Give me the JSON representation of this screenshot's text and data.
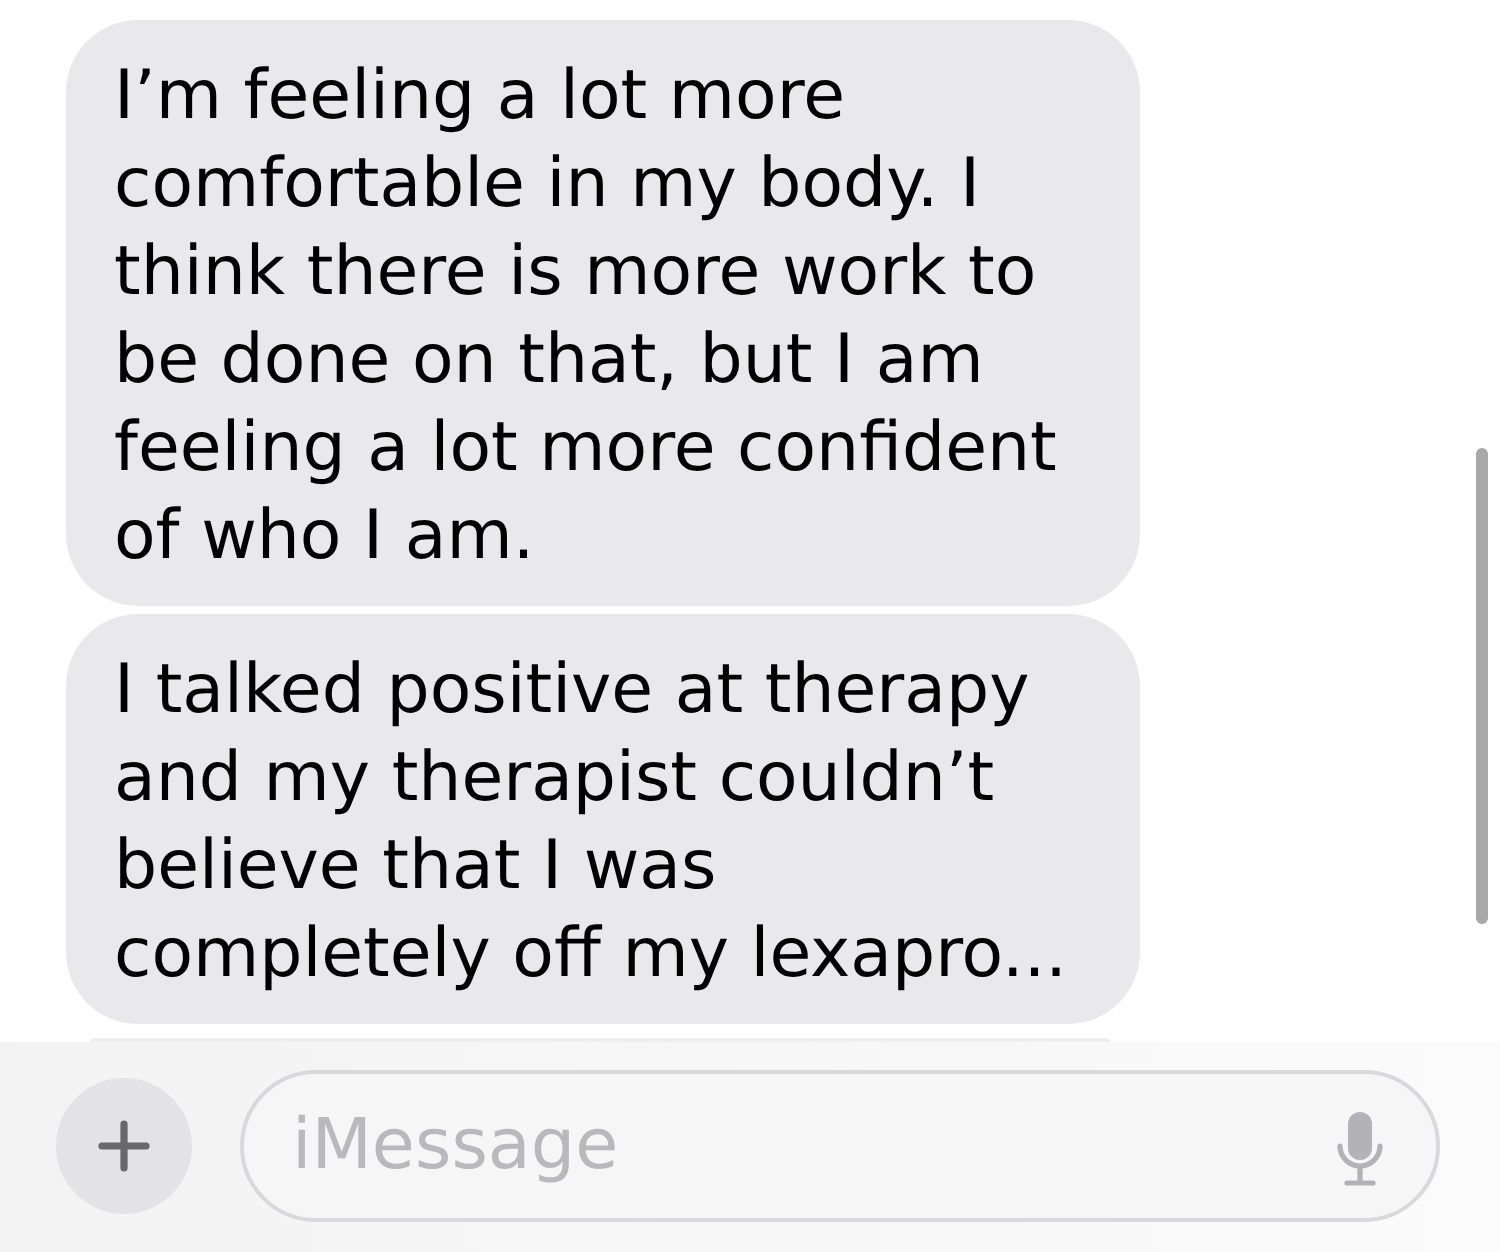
{
  "messages": [
    {
      "text": "I’m feeling a lot more comfortable in my body. I think there is more work to be done on that, but I am feeling a lot more confident of who I am."
    },
    {
      "text": "I talked positive at therapy and my therapist couldn’t believe that I was completely off my lexapro..."
    }
  ],
  "composer": {
    "placeholder": "iMessage"
  }
}
